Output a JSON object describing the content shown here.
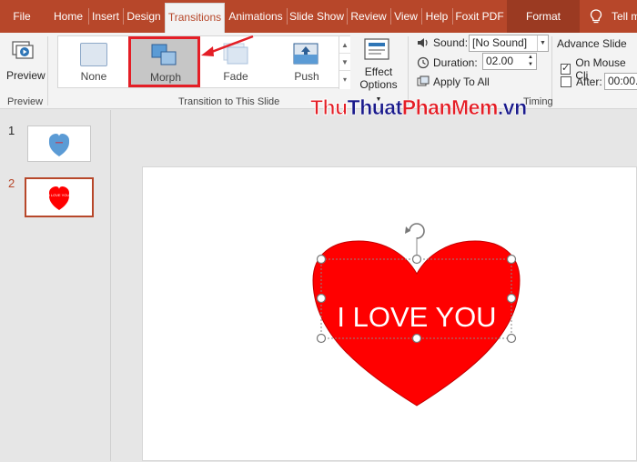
{
  "tabs": [
    {
      "label": "File"
    },
    {
      "label": "Home"
    },
    {
      "label": "Insert"
    },
    {
      "label": "Design"
    },
    {
      "label": "Transitions"
    },
    {
      "label": "Animations"
    },
    {
      "label": "Slide Show"
    },
    {
      "label": "Review"
    },
    {
      "label": "View"
    },
    {
      "label": "Help"
    },
    {
      "label": "Foxit PDF"
    },
    {
      "label": "Format"
    }
  ],
  "tell_me": "Tell m",
  "ribbon": {
    "preview": {
      "label": "Preview",
      "group_label": "Preview"
    },
    "transitions_gallery": {
      "items": [
        {
          "label": "None"
        },
        {
          "label": "Morph",
          "selected": true
        },
        {
          "label": "Fade"
        },
        {
          "label": "Push"
        }
      ],
      "group_label": "Transition to This Slide"
    },
    "effect_options": {
      "line1": "Effect",
      "line2": "Options"
    },
    "timing": {
      "sound_label": "Sound:",
      "sound_value": "[No Sound]",
      "duration_label": "Duration:",
      "duration_value": "02.00",
      "apply_all_label": "Apply To All",
      "advance_slide_label": "Advance Slide",
      "on_mouse_click_label": "On Mouse Cli",
      "on_mouse_click_checked": true,
      "after_label": "After:",
      "after_checked": false,
      "after_value": "00:00.",
      "group_label": "Timing"
    }
  },
  "watermark": {
    "part1": "Thu",
    "part2": "Thuat",
    "part3": "PhanMem",
    "part4": ".vn"
  },
  "slides_pane": {
    "slides": [
      {
        "number": "1",
        "selected": false,
        "heart_text": ""
      },
      {
        "number": "2",
        "selected": true,
        "heart_text": "I LOVE YOU"
      }
    ]
  },
  "slide": {
    "heart_text": "I LOVE YOU"
  },
  "colors": {
    "accent": "#b7472a",
    "heart_red": "#ff0000",
    "heart_blue": "#5b9bd5",
    "highlight": "#e41e26"
  }
}
